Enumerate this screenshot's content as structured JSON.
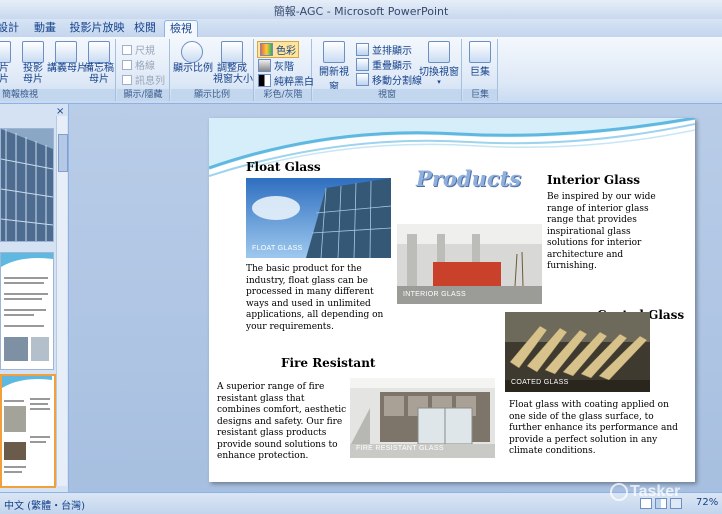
{
  "window": {
    "title": "簡報-AGC - Microsoft PowerPoint"
  },
  "tabs": [
    "設計",
    "動畫",
    "投影片放映",
    "校閱",
    "檢視"
  ],
  "ribbon": {
    "group_presentation_views": {
      "label": "簡報檢視",
      "buttons": [
        "片\n片",
        "投影\n母片",
        "講義母片",
        "備忘稿\n母片"
      ]
    },
    "group_show_hide": {
      "label": "顯示/隱藏",
      "items": [
        "尺規",
        "格線",
        "訊息列"
      ]
    },
    "group_zoom": {
      "label": "顯示比例",
      "buttons": [
        "顯示比例",
        "調整成\n視窗大小"
      ]
    },
    "group_color": {
      "label": "彩色/灰階",
      "items": [
        "色彩",
        "灰階",
        "純粹黑白"
      ]
    },
    "group_window": {
      "label": "視窗",
      "buttons": [
        "開新視窗"
      ],
      "items": [
        "並排顯示",
        "重疊顯示",
        "移動分割線"
      ],
      "switch_label": "切換視窗"
    },
    "group_macro": {
      "label": "巨集",
      "buttons": [
        "巨集"
      ]
    }
  },
  "slide": {
    "header": "Products",
    "float_glass": {
      "title": "Float Glass",
      "caption": "FLOAT GLASS",
      "body": "The basic product for the industry, float glass can be processed in many different ways and used in unlimited applications, all depending on your requirements."
    },
    "interior_glass": {
      "title": "Interior Glass",
      "caption": "INTERIOR GLASS",
      "body": "Be inspired by our wide range of interior glass range that provides inspirational glass solutions for interior architecture and furnishing."
    },
    "coated_glass": {
      "title": "Coated Glass",
      "caption": "COATED GLASS",
      "body": "Float glass with coating applied on one side of the glass surface, to further enhance its performance and provide a perfect solution in any climate conditions."
    },
    "fire_resistant": {
      "title": "Fire Resistant",
      "caption": "FIRE RESISTANT GLASS",
      "body": "A superior range of fire resistant glass that combines comfort, aesthetic designs and safety. Our fire resistant glass products provide sound solutions to enhance protection."
    }
  },
  "statusbar": {
    "language": "中文 (繁體・台灣)",
    "zoom": "72%",
    "watermark": "Tasker"
  },
  "colors": {
    "ribbon_text": "#15428b",
    "slide_wave": "#5fb8e0",
    "products_text": "#8fb0dc"
  }
}
